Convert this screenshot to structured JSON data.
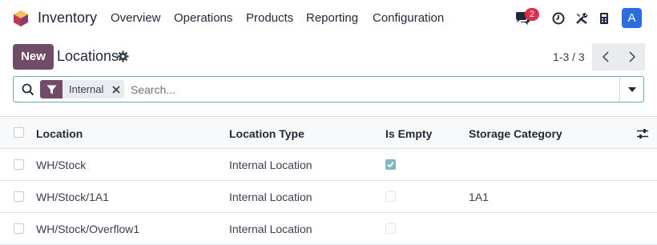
{
  "navbar": {
    "app_name": "Inventory",
    "menu": [
      "Overview",
      "Operations",
      "Products",
      "Reporting",
      "Configuration"
    ],
    "messages_count": "2",
    "user_initial": "A",
    "icons": [
      "chat-icon",
      "clock-icon",
      "tools-icon",
      "phone-icon"
    ]
  },
  "control": {
    "new_label": "New",
    "title": "Locations",
    "pager_value": "1-3 / 3"
  },
  "search": {
    "facet_value": "Internal",
    "placeholder": "Search..."
  },
  "table": {
    "columns": [
      "Location",
      "Location Type",
      "Is Empty",
      "Storage Category"
    ],
    "rows": [
      {
        "location": "WH/Stock",
        "type": "Internal Location",
        "is_empty": true,
        "storage_category": ""
      },
      {
        "location": "WH/Stock/1A1",
        "type": "Internal Location",
        "is_empty": false,
        "storage_category": "1A1"
      },
      {
        "location": "WH/Stock/Overflow1",
        "type": "Internal Location",
        "is_empty": false,
        "storage_category": ""
      }
    ]
  },
  "colors": {
    "brand": "#714b67",
    "accent": "#2d6cdf",
    "badge": "#dc2f4b",
    "checkbox_checked": "#7fb8bf"
  }
}
